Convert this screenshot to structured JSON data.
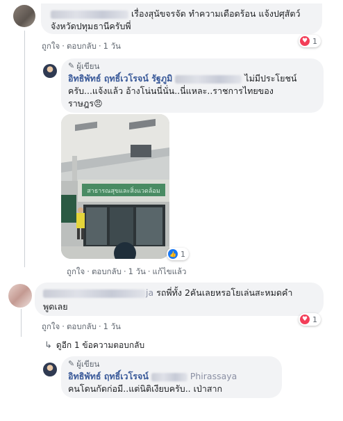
{
  "comments": [
    {
      "text": "เรื่องสุนัขจรจัด ทำความเดือดร้อน แจ้งปศุสัตว์จังหวัดปทุมธานีครับพี่",
      "text_line1": "เรื่องสุนัขจรจัด ทำความเดือดร้อน แจ้งปศุสัตว์",
      "text_line2": "จังหวัดปทุมธานีครับพี่",
      "actions": {
        "like": "ถูกใจ",
        "reply": "ตอบกลับ",
        "time": "1 วัน"
      },
      "reaction_count": "1",
      "reaction_type": "heart-icon"
    },
    {
      "author_tag": "ผู้เขียน",
      "author_name": "อิทธิพัทธ์ ฤทธิ์เวโรจน์ รัฐภูมิ",
      "author_suffix": "ไม่มีประโยชน์",
      "text_line2": "ครับ...แจ้งแล้ว อ้างโน่นนี่นั่น..นี่แหละ..ราชการไทยของ",
      "text_line3": "ราษฎร",
      "emoji": "😠",
      "photo_sign": "สาธารณสุขและสิ่งแวดล้อม",
      "actions": {
        "like": "ถูกใจ",
        "reply": "ตอบกลับ",
        "time": "1 วัน",
        "edited": "แก้ไขแล้ว"
      },
      "reaction_count": "1",
      "reaction_type": "thumbs-up-icon"
    },
    {
      "name_suffix": "ja",
      "text_line1": "รถพี่ทั้ง 2คันเลยหรอโยเล่นสะหมดคำ",
      "text_line2": "พูดเลย",
      "actions": {
        "like": "ถูกใจ",
        "reply": "ตอบกลับ",
        "time": "1 วัน"
      },
      "reaction_count": "1",
      "reaction_type": "heart-icon"
    }
  ],
  "view_replies": "ดูอีก 1 ข้อความตอบกลับ",
  "last_reply": {
    "author_tag": "ผู้เขียน",
    "author_name": "อิทธิพัทธ์ ฤทธิ์เวโรจน์",
    "author_suffix": "Phirassaya",
    "text": "คนโดนกัดก่อมี..แต่นิติเงียบครับ.. เป่าสาก"
  },
  "colors": {
    "link": "#385898",
    "meta": "#606770",
    "bubble": "#f2f3f5",
    "heart": "#f33e58",
    "like": "#1877f2"
  }
}
